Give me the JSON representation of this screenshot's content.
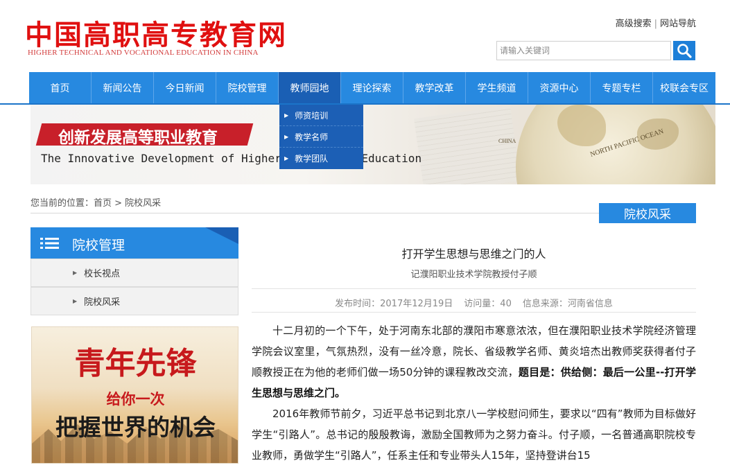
{
  "header": {
    "logo_cn": "中国高职高专教育网",
    "logo_en": "HIGHER TECHNICAL AND VOCATIONAL EDUCATION IN CHINA",
    "links": [
      "高级搜索",
      "网站导航"
    ],
    "link_sep": "|",
    "search_placeholder": "请输入关键词"
  },
  "nav": {
    "items": [
      "首页",
      "新闻公告",
      "今日新闻",
      "院校管理",
      "教师园地",
      "理论探索",
      "教学改革",
      "学生频道",
      "资源中心",
      "专题专栏",
      "校联会专区"
    ],
    "active": "教师园地",
    "dropdown": [
      "师资培训",
      "教学名师",
      "教学团队"
    ]
  },
  "banner": {
    "title": "创新发展高等职业教育",
    "subtitle": "The Innovative Development of Higher Vocational Education",
    "globe_label_1": "NORTH PACIFIC OCEAN",
    "globe_label_2": "CHINA"
  },
  "breadcrumb": "您当前的位置：首页 > 院校风采",
  "section_tab": "院校风采",
  "sidebar": {
    "title": "院校管理",
    "items": [
      "校长视点",
      "院校风采"
    ],
    "promo": {
      "line1": "青年先锋",
      "line2": "给你一次",
      "line3": "把握世界的机会"
    }
  },
  "article": {
    "title": "打开学生思想与思维之门的人",
    "subtitle": "记濮阳职业技术学院教授付子顺",
    "publish_time": "发布时间：2017年12月19日",
    "visits": "访问量：40",
    "source": "信息来源：河南省信息",
    "p1": "十二月初的一个下午，处于河南东北部的濮阳市寒意浓浓，但在濮阳职业技术学院经济管理学院会议室里，气氛热烈，没有一丝冷意，院长、省级教学名师、黄炎培杰出教师奖获得者付子顺教授正在为他的老师们做一场50分钟的课程教改交流，",
    "p1_bold": "题目是：供给侧：最后一公里--打开学生思想与思维之门。",
    "p2": "2016年教师节前夕，习近平总书记到北京八一学校慰问师生，要求以“四有”教师为目标做好学生“引路人”。总书记的殷殷教诲，激励全国教师为之努力奋斗。付子顺，一名普通高职院校专业教师，勇做学生“引路人”，任系主任和专业带头人15年，坚持登讲台15"
  }
}
